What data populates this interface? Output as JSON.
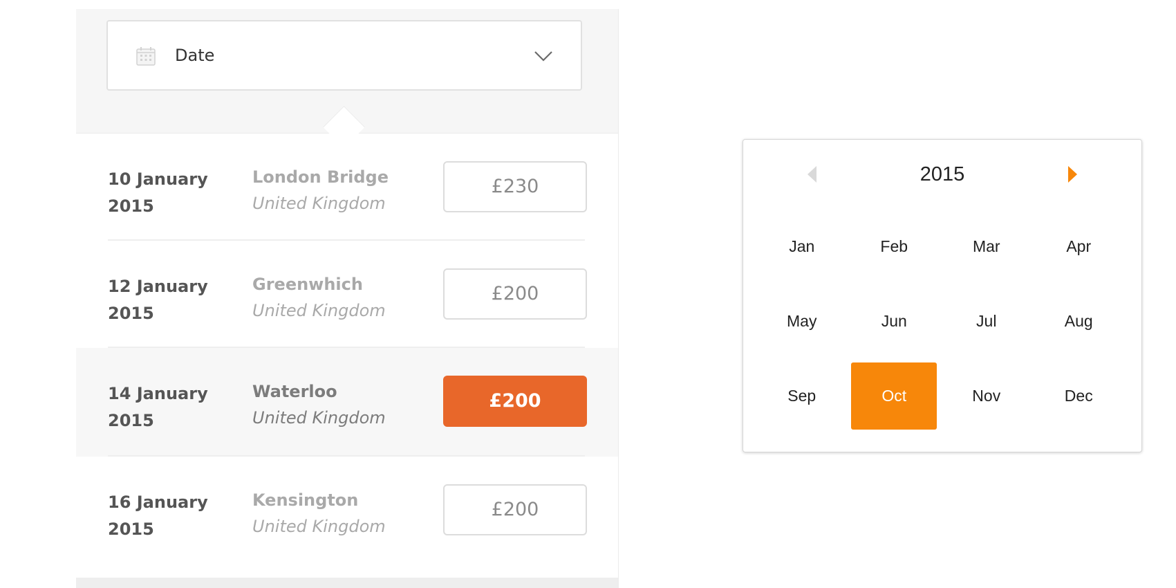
{
  "filter": {
    "label": "Date",
    "icon": "calendar-icon",
    "dropdown_icon": "chevron-down-icon"
  },
  "results": [
    {
      "date": "10 January 2015",
      "name": "London Bridge",
      "country": "United Kingdom",
      "price": "£230",
      "selected": false
    },
    {
      "date": "12 January 2015",
      "name": "Greenwhich",
      "country": "United Kingdom",
      "price": "£200",
      "selected": false
    },
    {
      "date": "14 January 2015",
      "name": "Waterloo",
      "country": "United Kingdom",
      "price": "£200",
      "selected": true
    },
    {
      "date": "16 January 2015",
      "name": "Kensington",
      "country": "United Kingdom",
      "price": "£200",
      "selected": false
    }
  ],
  "month_picker": {
    "year": "2015",
    "prev_icon": "triangle-left-icon",
    "next_icon": "triangle-right-icon",
    "months": [
      "Jan",
      "Feb",
      "Mar",
      "Apr",
      "May",
      "Jun",
      "Jul",
      "Aug",
      "Sep",
      "Oct",
      "Nov",
      "Dec"
    ],
    "selected": "Oct"
  },
  "colors": {
    "accent_orange": "#f7870a",
    "selected_price": "#e8672a",
    "text_dark": "#555555",
    "text_muted": "#a9a9a9"
  }
}
